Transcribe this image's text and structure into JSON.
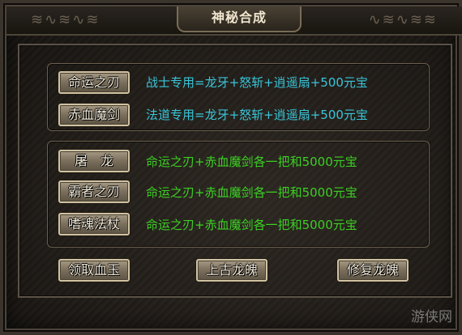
{
  "window": {
    "title": "神秘合成"
  },
  "weapons_top": [
    {
      "label": "命运之刃",
      "recipe": "战士专用=龙牙+怒斩+逍遥扇+500元宝"
    },
    {
      "label": "赤血魔剑",
      "recipe": "法道专用=龙牙+怒斩+逍遥扇+500元宝"
    }
  ],
  "weapons_bottom": [
    {
      "label": "屠　龙",
      "recipe": "命运之刃+赤血魔剑各一把和5000元宝"
    },
    {
      "label": "霸者之刃",
      "recipe": "命运之刃+赤血魔剑各一把和5000元宝"
    },
    {
      "label": "嗜魂法杖",
      "recipe": "命运之刃+赤血魔剑各一把和5000元宝"
    }
  ],
  "actions": {
    "collect_blood_jade": "领取血玉",
    "submit_ancient_soul": "上古龙魄",
    "repair_dragon_soul": "修复龙魄"
  },
  "watermark": "游侠网",
  "colors": {
    "recipe_top": "#39c5d9",
    "recipe_bottom": "#3bd023",
    "button_text": "#f2ead8"
  }
}
